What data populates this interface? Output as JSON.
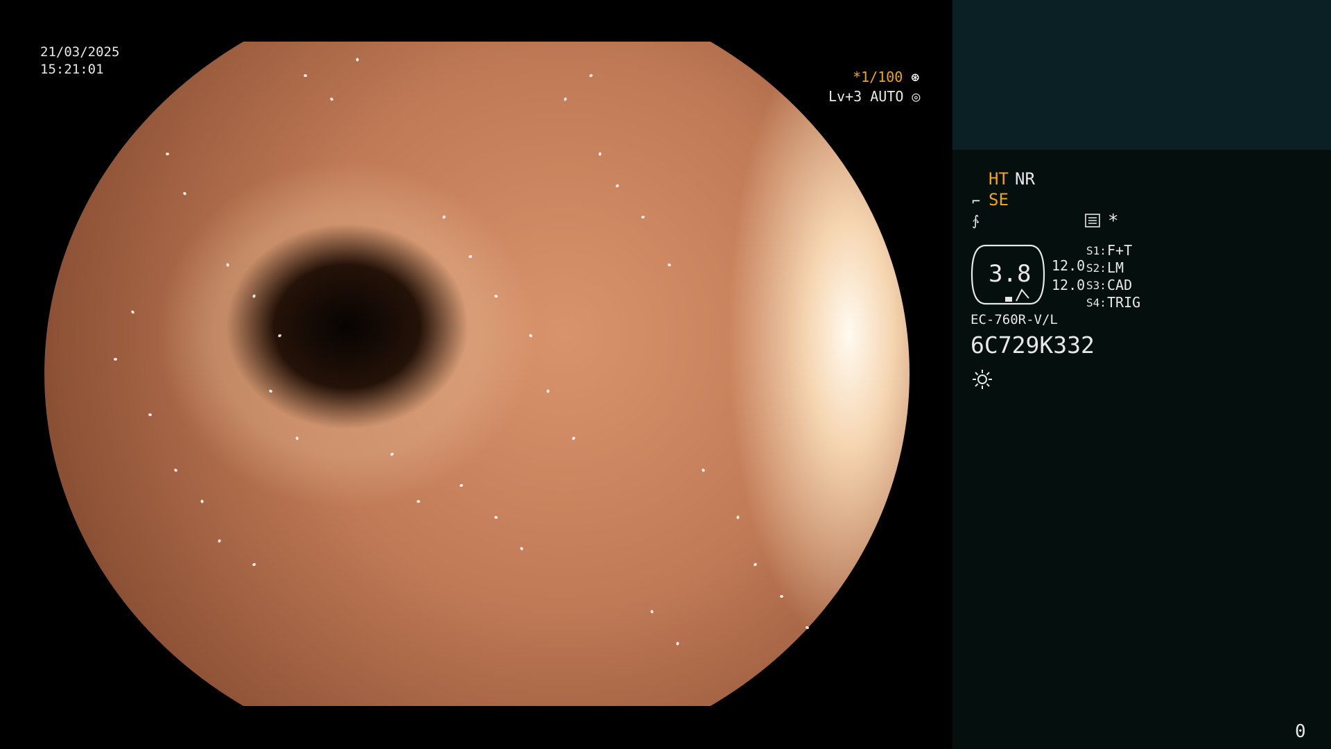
{
  "datetime": {
    "date": "21/03/2025",
    "time": "15:21:01"
  },
  "imaging": {
    "shutter": "*1/100",
    "level": "Lv+3 AUTO"
  },
  "modes": {
    "ht": "HT",
    "nr": "NR",
    "se": "SE",
    "asterisk": "*"
  },
  "gauge": {
    "value": "3.8",
    "val1": "12.0",
    "val2": "12.0"
  },
  "switches": [
    {
      "label": "S1:",
      "value": "F+T"
    },
    {
      "label": "S2:",
      "value": "LM"
    },
    {
      "label": "S3:",
      "value": "CAD"
    },
    {
      "label": "S4:",
      "value": "TRIG"
    }
  ],
  "scope": {
    "model": "EC-760R-V/L",
    "serial": "6C729K332"
  },
  "counter": "0",
  "colors": {
    "accent": "#f2a417",
    "sidebar_top": "#0b2024",
    "sidebar": "#050f0e"
  },
  "icons": [
    "shutter-icon",
    "auto-iris-icon",
    "enhancement-icon",
    "structure-icon",
    "memo-icon",
    "light-source-icon"
  ]
}
